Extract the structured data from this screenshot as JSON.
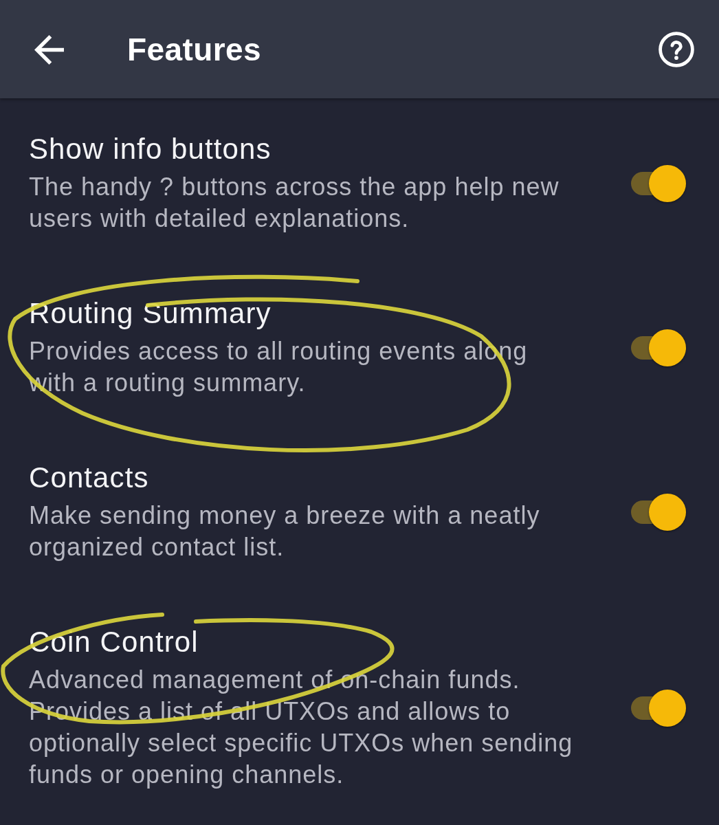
{
  "header": {
    "title": "Features"
  },
  "features": [
    {
      "title": "Show info buttons",
      "description": "The handy ? buttons across the app help new users with detailed explanations.",
      "on": true,
      "circled": false
    },
    {
      "title": "Routing Summary",
      "description": "Provides access to all routing events along with a routing summary.",
      "on": true,
      "circled": true
    },
    {
      "title": "Contacts",
      "description": "Make sending money a breeze with a neatly organized contact list.",
      "on": true,
      "circled": false
    },
    {
      "title": "Coin Control",
      "description": "Advanced management of on-chain funds. Provides a list of all UTXOs and allows to optionally select specific UTXOs when sending funds or opening channels.",
      "on": true,
      "circled": true
    }
  ]
}
